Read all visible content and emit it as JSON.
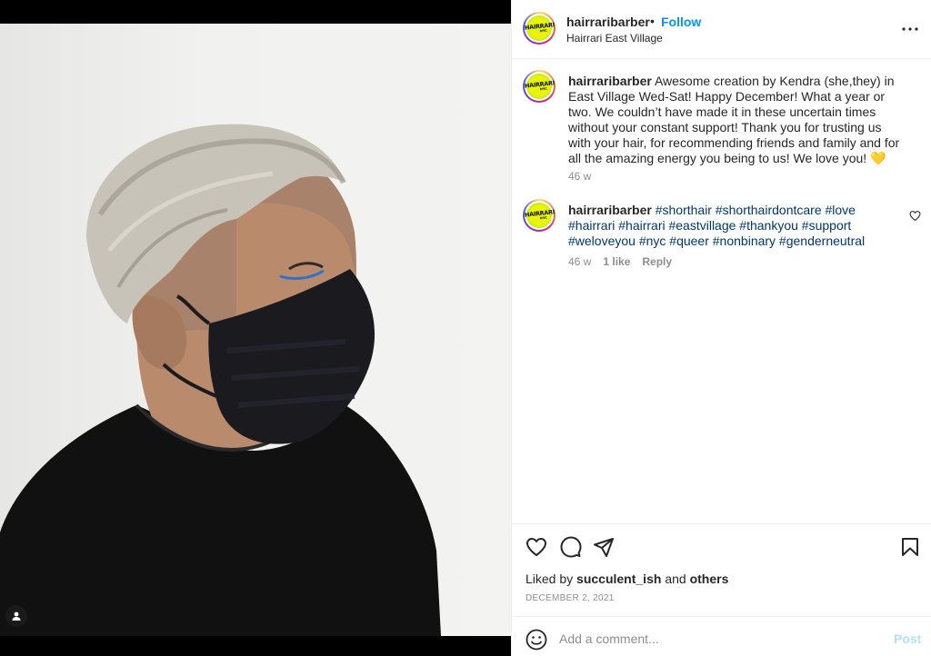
{
  "post": {
    "username": "hairraribarber",
    "separator": "•",
    "follow_label": "Follow",
    "location": "Hairrari East Village",
    "more_icon": "more-horizontal-icon",
    "avatar_text_line1": "HAIRRARI",
    "avatar_text_line2": "NYC"
  },
  "caption": {
    "username": "hairraribarber",
    "text": "Awesome creation by Kendra (she,they) in East Village Wed-Sat! Happy December! What a year or two. We couldn’t have made it in these uncertain times without your constant support! Thank you for trusting us with your hair, for recommending friends and family and for all the amazing energy you being to us! We love you! 💛",
    "time": "46 w"
  },
  "comments": [
    {
      "username": "hairraribarber",
      "text": "#shorthair #shorthairdontcare #love #hairrari #hairrari #eastvillage #thankyou #support #weloveyou #nyc #queer #nonbinary #genderneutral",
      "time": "46 w",
      "likes": "1 like",
      "reply_label": "Reply"
    }
  ],
  "actions": {
    "like_icon": "heart-icon",
    "comment_icon": "comment-icon",
    "share_icon": "send-icon",
    "save_icon": "bookmark-icon"
  },
  "likes": {
    "prefix": "Liked by",
    "user": "succulent_ish",
    "and": "and",
    "others": "others"
  },
  "date": "DECEMBER 2, 2021",
  "add_comment": {
    "placeholder": "Add a comment...",
    "post_label": "Post",
    "emoji_icon": "emoji-icon"
  },
  "colors": {
    "accent": "#0095f6",
    "hashtag": "#00376b",
    "muted": "#8e8e8e",
    "post_disabled": "#b2dffc"
  }
}
